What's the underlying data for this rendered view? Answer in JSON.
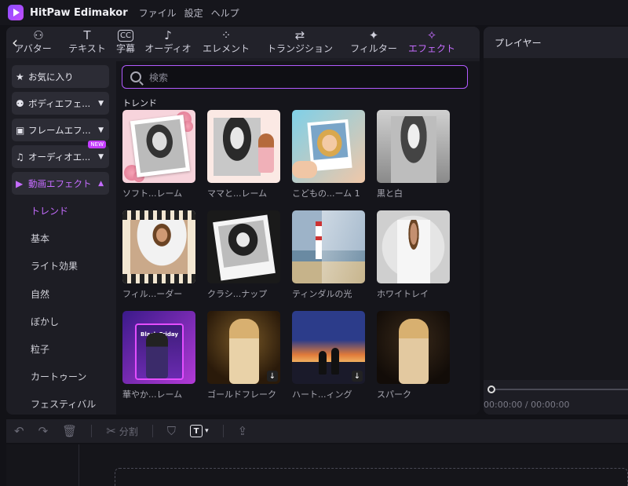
{
  "app": {
    "title": "HitPaw Edimakor"
  },
  "menu": [
    "ファイル",
    "設定",
    "ヘルプ"
  ],
  "toolbar": {
    "back": "‹",
    "tabs": [
      {
        "label": "アバター",
        "icon": "avatar-icon",
        "glyph": "⚇"
      },
      {
        "label": "テキスト",
        "icon": "text-icon",
        "glyph": "T"
      },
      {
        "label": "字幕",
        "icon": "subtitle-icon",
        "glyph": "CC"
      },
      {
        "label": "オーディオ",
        "icon": "music-icon",
        "glyph": "♪"
      },
      {
        "label": "エレメント",
        "icon": "element-icon",
        "glyph": "⁘"
      },
      {
        "label": "トランジション",
        "icon": "transition-icon",
        "glyph": "⇄"
      },
      {
        "label": "フィルター",
        "icon": "filter-icon",
        "glyph": "✦"
      },
      {
        "label": "エフェクト",
        "icon": "effect-icon",
        "glyph": "✧"
      }
    ],
    "active": "エフェクト"
  },
  "sidebar": {
    "categories": [
      {
        "label": "お気に入り",
        "icon": "star-icon",
        "glyph": "★"
      },
      {
        "label": "ボディエフェ...",
        "icon": "person-icon",
        "glyph": "⚉"
      },
      {
        "label": "フレームエフ...",
        "icon": "frame-icon",
        "glyph": "▣"
      },
      {
        "label": "オーディオエ...",
        "icon": "microphone-icon",
        "glyph": "♫",
        "badge": "NEW"
      },
      {
        "label": "動画エフェクト",
        "icon": "video-icon",
        "glyph": "▶"
      }
    ],
    "subcategories": [
      "トレンド",
      "基本",
      "ライト効果",
      "自然",
      "ぼかし",
      "粒子",
      "カートゥーン",
      "フェスティバル"
    ],
    "active_sub": "トレンド"
  },
  "search": {
    "placeholder": "検索"
  },
  "section": {
    "title": "トレンド"
  },
  "effects": [
    {
      "label": "ソフト...レーム",
      "download": false
    },
    {
      "label": "ママと...レーム",
      "download": false
    },
    {
      "label": "こどもの...ーム 1",
      "download": false
    },
    {
      "label": "黒と白",
      "download": false
    },
    {
      "label": "フィル...ーダー",
      "download": false
    },
    {
      "label": "クラシ...ナップ",
      "download": false
    },
    {
      "label": "ティンダルの光",
      "download": false
    },
    {
      "label": "ホワイトレイ",
      "download": false
    },
    {
      "label": "華やか...レーム",
      "download": false,
      "overlay_text": "Black Friday"
    },
    {
      "label": "ゴールドフレーク",
      "download": true
    },
    {
      "label": "ハート...ィング",
      "download": true
    },
    {
      "label": "スパーク",
      "download": false
    }
  ],
  "player": {
    "title": "プレイヤー",
    "current": "00:00:00",
    "separator": "/",
    "total": "00:00:00"
  },
  "timeline": {
    "split_label": "分割",
    "undo": "↶",
    "redo": "↷",
    "delete": "🗑",
    "scissors": "✂",
    "shield": "⛉",
    "text_tool": "T",
    "caret": "▾",
    "export": "⇪"
  },
  "colors": {
    "accent": "#c56cff",
    "search_border": "#b25aff",
    "background": "#121217",
    "panel": "#1d1d24"
  }
}
